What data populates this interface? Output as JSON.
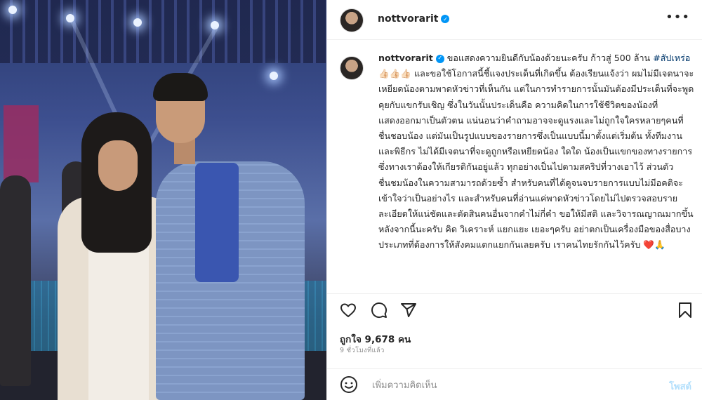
{
  "post": {
    "username": "nottvorarit",
    "verified": true,
    "caption_user": "nottvorarit",
    "caption_part1": "ขอแสดงความยินดีกับน้องด้วยนะครับ ก้าวสู่ 500 ล้าน",
    "hashtag": "#สัปเหร่อ",
    "caption_part2": "👍🏻👍🏻👍🏻 และขอใช้โอกาสนี้ชี้แจงประเด็นที่เกิดขึ้น ต้องเรียนแจ้งว่า ผมไม่มีเจตนาจะเหยียดน้องตามพาดหัวข่าวที่เห็นกัน แต่ในการทำรายการนั้นมันต้องมีประเด็นที่จะพูดคุยกับแขกรับเชิญ ซึ่งในวันนั้นประเด็นคือ ความคิดในการใช้ชีวิตของน้องที่แสดงออกมาเป็นตัวตน แน่นอนว่าคำถามอาจจะดูแรงและไม่ถูกใจใครหลายๆคนที่ชื่นชอบน้อง แต่มันเป็นรูปแบบของรายการซึ่งเป็นแบบนี้มาตั้งแต่เริ่มต้น ทั้งทีมงานและพิธีกร ไม่ได้มีเจตนาที่จะดูถูกหรือเหยียดน้อง ใดใด น้องเป็นแขกของทางรายการซึ่งทางเราต้องให้เกียรติกันอยู่แล้ว ทุกอย่างเป็นไปตามสคริปที่วางเอาไว้ ส่วนตัวชื่นชมน้องในความสามารถด้วยซ้ำ สำหรับคนที่ได้ดูจนจบรายการแบบไม่มีอคติจะเข้าใจว่าเป็นอย่างไร และสำหรับคนที่อ่านแค่พาดหัวข่าวโดยไม่ไปตรวจสอบรายละเอียดให้แน่ชัดและตัดสินคนอื่นจากคำไม่กี่คำ ขอให้มีสติ และวิจารณญาณมากขึ้นหลังจากนี้นะครับ คิด วิเคราะห์ แยกแยะ เยอะๆครับ อย่าตกเป็นเครื่องมือของสื่อบางประเภทที่ต้องการให้สังคมแตกแยกกันเลยครับ เราคนไทยรักกันไว้ครับ ❤️🙏"
  },
  "stats": {
    "likes": "ถูกใจ 9,678 คน",
    "time": "9 ชั่วโมงที่แล้ว"
  },
  "comment": {
    "placeholder": "เพิ่มความคิดเห็น",
    "post_label": "โพสต์"
  },
  "icons": {
    "more": "more-options-icon",
    "like": "heart-icon",
    "comment": "comment-icon",
    "share": "share-icon",
    "save": "bookmark-icon",
    "emoji": "emoji-icon",
    "verified": "verified-badge-icon"
  },
  "colors": {
    "verified": "#0095f6",
    "hashtag": "#00376b",
    "post_button": "#b2dffc",
    "secondary_text": "#8e8e8e"
  }
}
